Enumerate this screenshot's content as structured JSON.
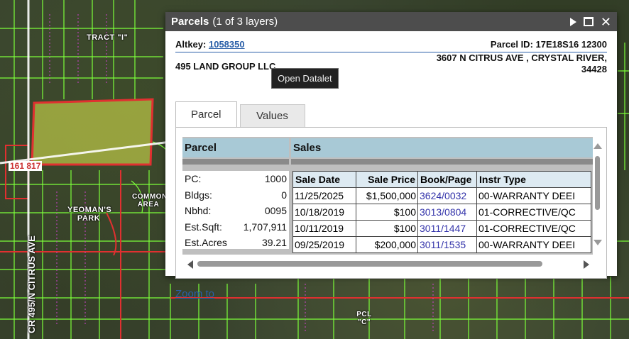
{
  "map": {
    "labels": {
      "tract": "TRACT \"I\"",
      "common_area": "COMMON AREA",
      "yeomans_park": "YEOMAN'S PARK",
      "pcl_c": "PCL \"C\"",
      "road": "CR 495/N CITRUS AVE",
      "parcel_tag": "161 817"
    }
  },
  "popup": {
    "title": "Parcels",
    "subtitle": "(1 of 3 layers)",
    "altkey_label": "Altkey:",
    "altkey_value": "1058350",
    "parcel_id": "Parcel ID: 17E18S16 12300",
    "owner": "495 LAND GROUP LLC",
    "address_line1": "3607 N CITRUS AVE , CRYSTAL RIVER,",
    "address_line2": "34428",
    "tooltip": "Open Datalet",
    "tabs": [
      {
        "label": "Parcel"
      },
      {
        "label": "Values"
      }
    ],
    "sections": {
      "parcel": "Parcel",
      "sales": "Sales"
    },
    "parcel_info": [
      {
        "label": "PC:",
        "value": "1000"
      },
      {
        "label": "Bldgs:",
        "value": "0"
      },
      {
        "label": "Nbhd:",
        "value": "0095"
      },
      {
        "label": "Est.Sqft:",
        "value": "1,707,911"
      },
      {
        "label": "Est.Acres",
        "value": "39.21"
      }
    ],
    "sales_headers": [
      "Sale Date",
      "Sale Price",
      "Book/Page",
      "Instr Type"
    ],
    "sales_rows": [
      {
        "date": "11/25/2025",
        "price": "$1,500,000",
        "book": "3624/0032",
        "instr": "00-WARRANTY DEEI"
      },
      {
        "date": "10/18/2019",
        "price": "$100",
        "book": "3013/0804",
        "instr": "01-CORRECTIVE/QC"
      },
      {
        "date": "10/11/2019",
        "price": "$100",
        "book": "3011/1447",
        "instr": "01-CORRECTIVE/QC"
      },
      {
        "date": "09/25/2019",
        "price": "$200,000",
        "book": "3011/1535",
        "instr": "00-WARRANTY DEEI"
      }
    ],
    "zoom_to": "Zoom to"
  },
  "colors": {
    "header_bg": "#4d4d4d",
    "section_header": "#a8c9d6",
    "link": "#2a5fa8",
    "parcel_line": "#7cff3a",
    "highlight": "#c8d24a"
  }
}
